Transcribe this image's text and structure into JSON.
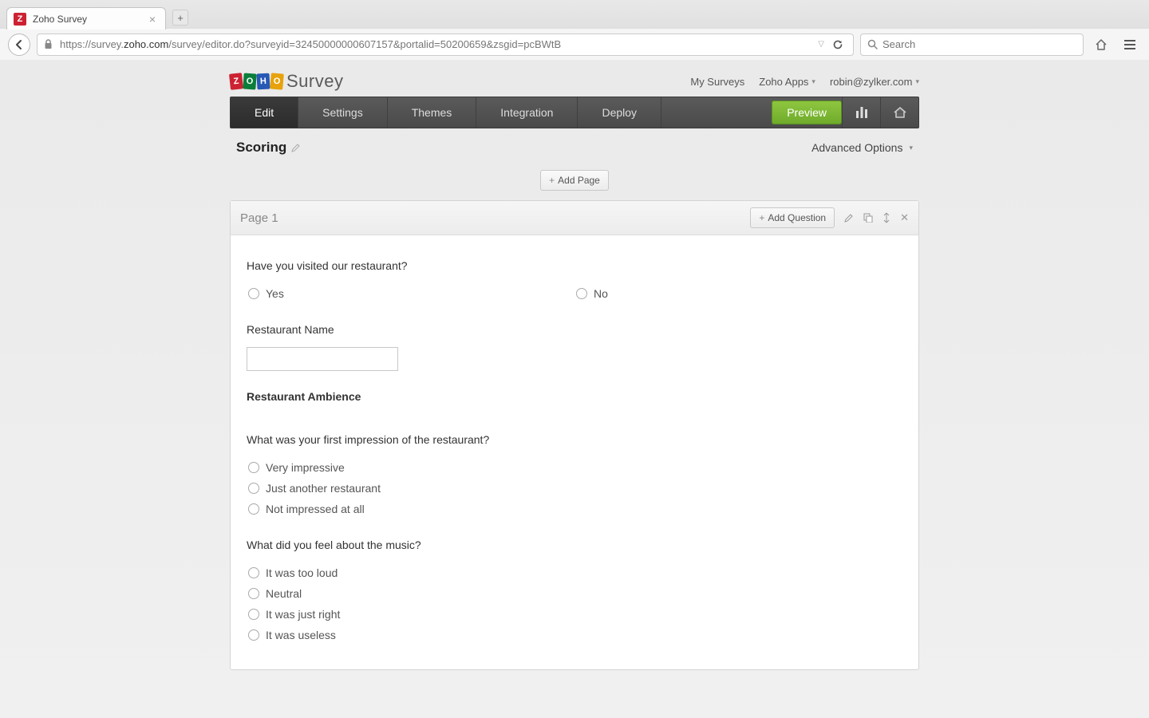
{
  "browser": {
    "tab_title": "Zoho Survey",
    "url_host": "zoho.com",
    "url_prefix": "https://survey.",
    "url_path": "/survey/editor.do?surveyid=32450000000607157&portalid=50200659&zsgid=pcBWtB",
    "search_placeholder": "Search"
  },
  "header": {
    "logo_word": "Survey",
    "links": {
      "my_surveys": "My Surveys",
      "zoho_apps": "Zoho Apps",
      "user_email": "robin@zylker.com"
    }
  },
  "nav": {
    "items": [
      "Edit",
      "Settings",
      "Themes",
      "Integration",
      "Deploy"
    ],
    "preview": "Preview"
  },
  "subheader": {
    "title": "Scoring",
    "advanced": "Advanced Options"
  },
  "actions": {
    "add_page": "Add Page",
    "add_question": "Add Question"
  },
  "page": {
    "title": "Page 1",
    "questions": [
      {
        "text": "Have you visited our restaurant?",
        "type": "radio-row",
        "options": [
          "Yes",
          "No"
        ]
      },
      {
        "text": "Restaurant Name",
        "type": "text"
      },
      {
        "text": "Restaurant Ambience",
        "type": "section"
      },
      {
        "text": "What was your first impression of the restaurant?",
        "type": "radio",
        "options": [
          "Very impressive",
          "Just another restaurant",
          "Not impressed at all"
        ]
      },
      {
        "text": "What did you feel about the music?",
        "type": "radio",
        "options": [
          "It was too loud",
          "Neutral",
          "It was just right",
          "It was useless"
        ]
      }
    ]
  }
}
